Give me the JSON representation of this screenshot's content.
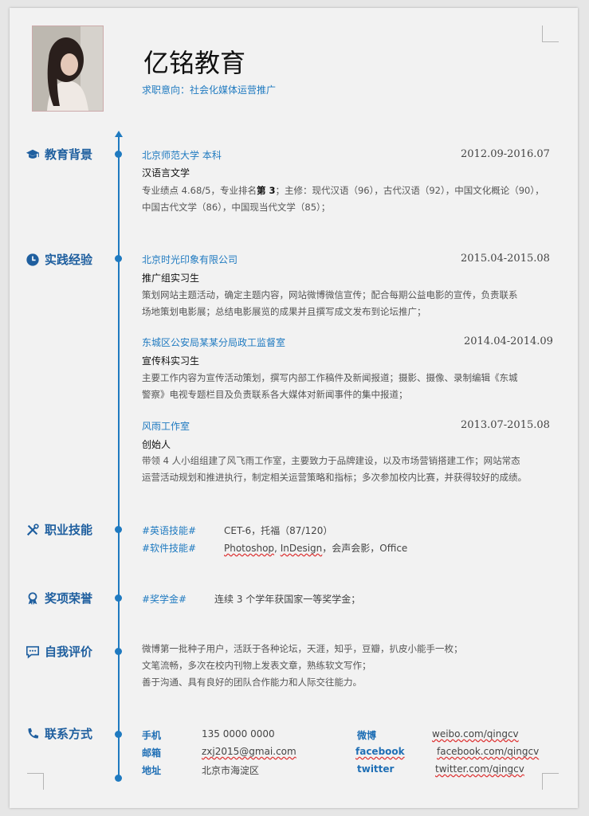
{
  "header": {
    "name": "亿铭教育",
    "intent": "求职意向：社会化媒体运营推广"
  },
  "sections": {
    "education": "教育背景",
    "practice": "实践经验",
    "skills": "职业技能",
    "awards": "奖项荣誉",
    "self": "自我评价",
    "contact": "联系方式"
  },
  "education": {
    "school": "北京师范大学  本科",
    "date": "2012.09-2016.07",
    "major": "汉语言文学",
    "line1_a": "专业绩点 4.68/5，专业排名",
    "line1_b": "第 3",
    "line1_c": "；主修：现代汉语（96），古代汉语（92），中国文化概论（90），",
    "line2": "中国古代文学（86），中国现当代文学（85）；"
  },
  "practice": [
    {
      "org": "北京时光印象有限公司",
      "date": "2015.04-2015.08",
      "role": "推广组实习生",
      "desc1": "策划网站主题活动，确定主题内容，网站微博微信宣传；配合每期公益电影的宣传，负责联系",
      "desc2": "场地策划电影展；总结电影展览的成果并且撰写成文发布到论坛推广；"
    },
    {
      "org": "东城区公安局某某分局政工监督室",
      "date": "2014.04-2014.09",
      "role": "宣传科实习生",
      "desc1": "主要工作内容为宣传活动策划，撰写内部工作稿件及新闻报道；摄影、摄像、录制编辑《东城",
      "desc2": "警察》电视专题栏目及负责联系各大媒体对新闻事件的集中报道；"
    },
    {
      "org": "风雨工作室",
      "date": "2013.07-2015.08",
      "role": "创始人",
      "desc1": "带领 4 人小组组建了风飞雨工作室，主要致力于品牌建设，以及市场营销搭建工作；网站常态",
      "desc2": "运营活动规划和推进执行，制定相关运营策略和指标；多次参加校内比赛，并获得较好的成绩。"
    }
  ],
  "skills": [
    {
      "label": "#英语技能#",
      "value": "CET-6，托福（87/120）"
    },
    {
      "label": "#软件技能#",
      "value_a": "Photoshop",
      "value_b": ", ",
      "value_c": "InDesign",
      "value_d": "，会声会影，Office"
    }
  ],
  "awards": [
    {
      "label": "#奖学金#",
      "value": "连续 3 个学年获国家一等奖学金；"
    }
  ],
  "self": [
    "微博第一批种子用户，活跃于各种论坛，天涯，知乎，豆瓣，扒皮小能手一枚；",
    "文笔流畅，多次在校内刊物上发表文章，熟练软文写作；",
    "善于沟通、具有良好的团队合作能力和人际交往能力。"
  ],
  "contact": {
    "phone_label": "手机",
    "phone": "135 0000 0000",
    "email_label": "邮箱",
    "email": "zxj2015@gmai.com",
    "addr_label": "地址",
    "addr": "北京市海淀区",
    "weibo_label": "微博",
    "weibo": "weibo.com/qingcv",
    "fb_label": "facebook",
    "fb": "facebook.com/qingcv",
    "tw_label": "twitter",
    "tw": "twitter.com/qingcv"
  },
  "colors": {
    "accent": "#1f7ac0",
    "heading": "#1f5f9f"
  }
}
